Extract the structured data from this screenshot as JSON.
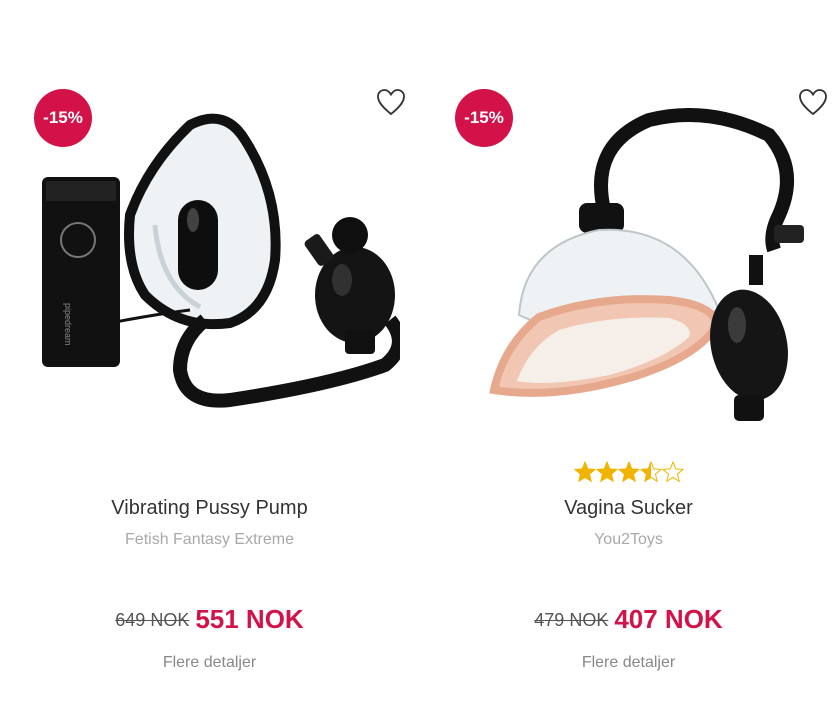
{
  "products": [
    {
      "discount_badge": "-15%",
      "title": "Vibrating Pussy Pump",
      "brand": "Fetish Fantasy Extreme",
      "old_price": "649 NOK",
      "new_price": "551 NOK",
      "details_link": "Flere detaljer",
      "icons": [
        "heart-outline-icon"
      ]
    },
    {
      "discount_badge": "-15%",
      "rating": 3.5,
      "rating_max": 5,
      "title": "Vagina Sucker",
      "brand": "You2Toys",
      "old_price": "479 NOK",
      "new_price": "407 NOK",
      "details_link": "Flere detaljer",
      "icons": [
        "heart-outline-icon",
        "star-icon"
      ]
    }
  ],
  "colors": {
    "accent": "#d3124a",
    "star": "#f0b400",
    "muted_text": "#a8a8a8"
  }
}
